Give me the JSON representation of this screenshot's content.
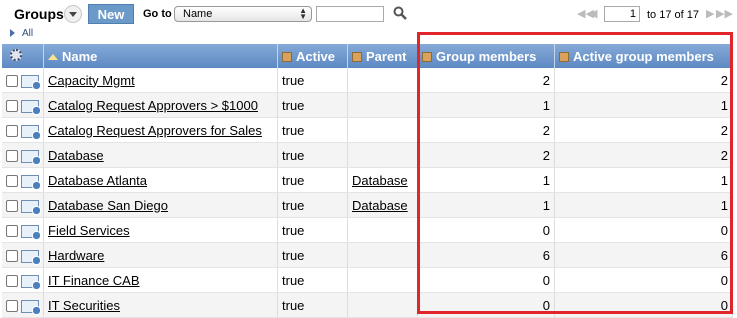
{
  "toolbar": {
    "title": "Groups",
    "new_label": "New",
    "goto_label": "Go to",
    "goto_field": "Name",
    "goto_value": "",
    "page_current": "1",
    "page_of": "to 17 of 17"
  },
  "breadcrumb": {
    "all": "All"
  },
  "table": {
    "columns": {
      "name": "Name",
      "active": "Active",
      "parent": "Parent",
      "group_members": "Group members",
      "active_group_members": "Active group members"
    },
    "rows": [
      {
        "name": "Capacity Mgmt",
        "active": "true",
        "parent": "",
        "members": "2",
        "active_members": "2"
      },
      {
        "name": "Catalog Request Approvers > $1000",
        "active": "true",
        "parent": "",
        "members": "1",
        "active_members": "1"
      },
      {
        "name": "Catalog Request Approvers for Sales",
        "active": "true",
        "parent": "",
        "members": "2",
        "active_members": "2"
      },
      {
        "name": "Database",
        "active": "true",
        "parent": "",
        "members": "2",
        "active_members": "2"
      },
      {
        "name": "Database Atlanta",
        "active": "true",
        "parent": "Database",
        "members": "1",
        "active_members": "1"
      },
      {
        "name": "Database San Diego",
        "active": "true",
        "parent": "Database",
        "members": "1",
        "active_members": "1"
      },
      {
        "name": "Field Services",
        "active": "true",
        "parent": "",
        "members": "0",
        "active_members": "0"
      },
      {
        "name": "Hardware",
        "active": "true",
        "parent": "",
        "members": "6",
        "active_members": "6"
      },
      {
        "name": "IT Finance CAB",
        "active": "true",
        "parent": "",
        "members": "0",
        "active_members": "0"
      },
      {
        "name": "IT Securities",
        "active": "true",
        "parent": "",
        "members": "0",
        "active_members": "0"
      }
    ]
  },
  "colors": {
    "header": "#6f97cc",
    "highlight": "#e0262b"
  }
}
